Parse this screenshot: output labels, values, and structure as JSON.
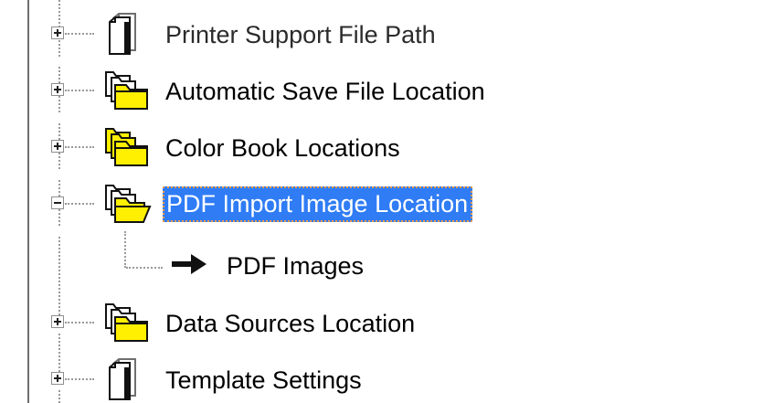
{
  "tree": {
    "nodes": [
      {
        "label": "Printer Support File Path",
        "icon": "document-icon",
        "expander": "plus",
        "selected": false
      },
      {
        "label": "Automatic Save File Location",
        "icon": "folder-stack-icon",
        "expander": "plus",
        "selected": false
      },
      {
        "label": "Color Book Locations",
        "icon": "folder-stack-icon",
        "expander": "plus",
        "selected": false
      },
      {
        "label": "PDF Import Image Location",
        "icon": "open-folder-stack-icon",
        "expander": "minus",
        "selected": true
      },
      {
        "label": "Data Sources Location",
        "icon": "folder-stack-icon",
        "expander": "plus",
        "selected": false
      },
      {
        "label": "Template Settings",
        "icon": "document-icon",
        "expander": "plus",
        "selected": false
      }
    ],
    "child": {
      "label": "PDF Images",
      "icon": "arrow-right-icon"
    }
  },
  "colors": {
    "selection_background": "#2f7cf5",
    "selection_text": "#ffffff",
    "focus_outline": "#f29b48",
    "folder_yellow": "#ffef00"
  }
}
